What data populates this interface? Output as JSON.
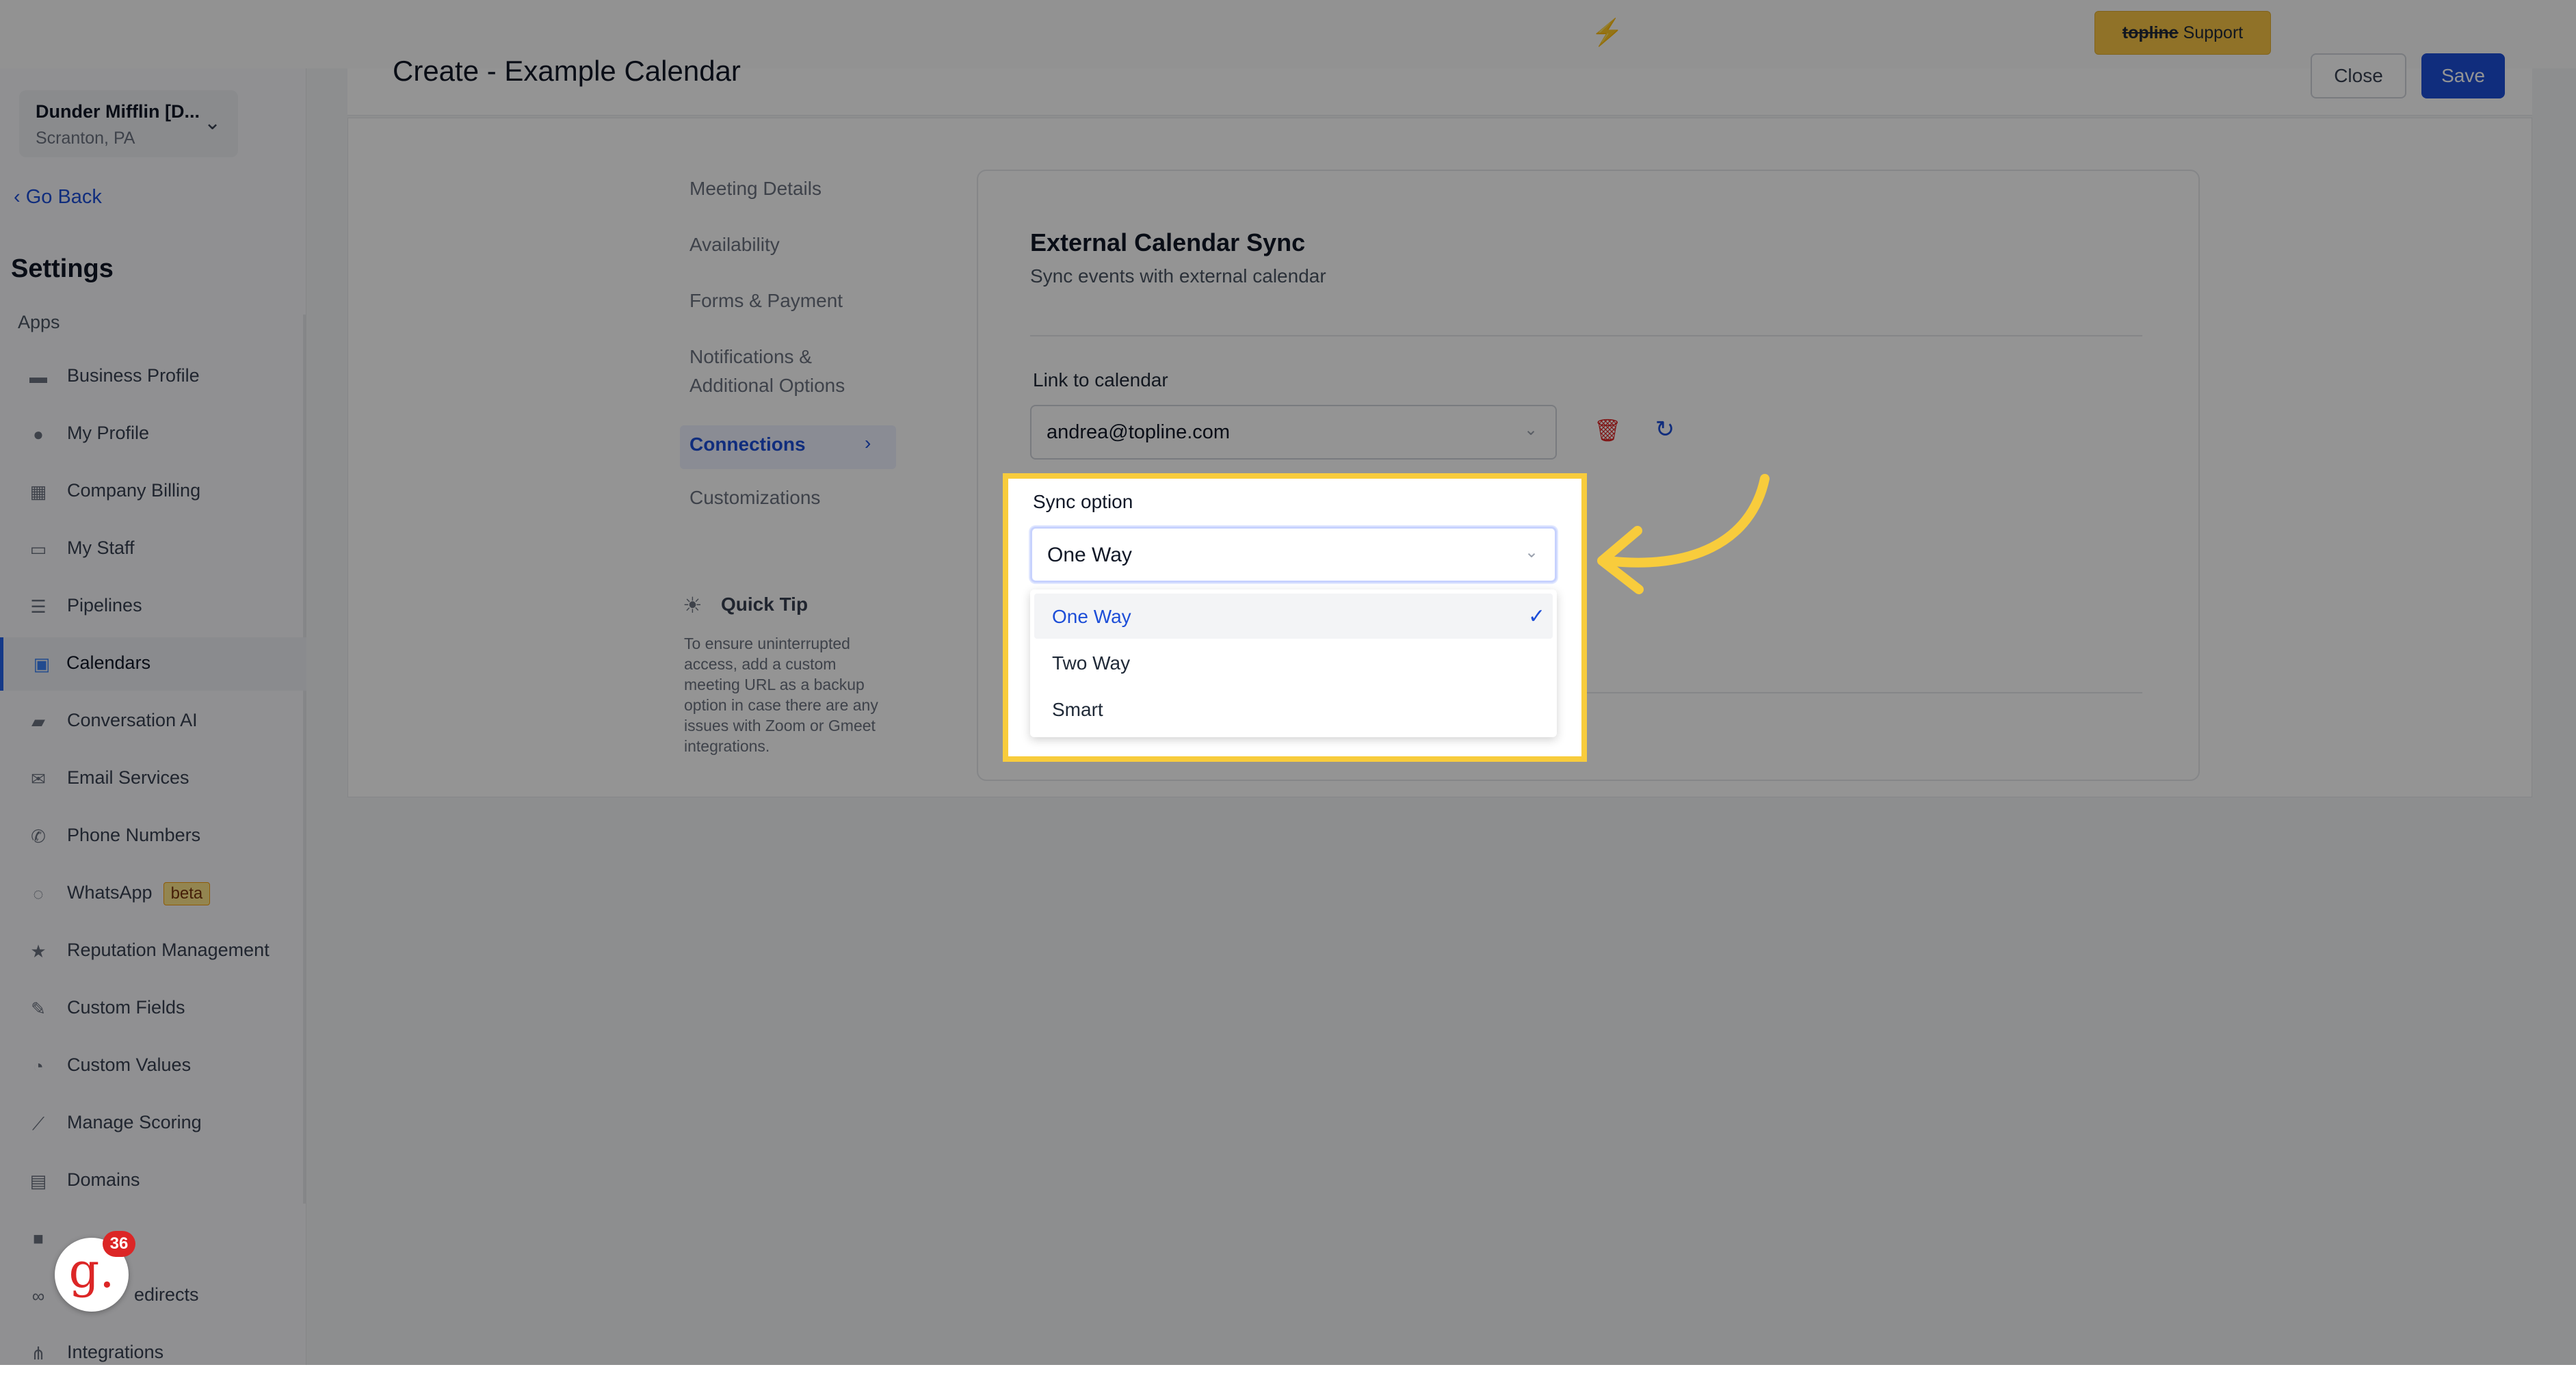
{
  "topbar": {
    "support_brand": "topline",
    "support_label": "Support"
  },
  "sidebar": {
    "account_name": "Dunder Mifflin [D...",
    "account_location": "Scranton, PA",
    "go_back": "Go Back",
    "settings_title": "Settings",
    "apps_label": "Apps",
    "beta_badge": "beta",
    "items": [
      {
        "label": "Business Profile",
        "icon": "briefcase-icon"
      },
      {
        "label": "My Profile",
        "icon": "user-icon"
      },
      {
        "label": "Company Billing",
        "icon": "grid-icon"
      },
      {
        "label": "My Staff",
        "icon": "inbox-icon"
      },
      {
        "label": "Pipelines",
        "icon": "filter-icon"
      },
      {
        "label": "Calendars",
        "icon": "calendar-icon"
      },
      {
        "label": "Conversation AI",
        "icon": "chat-icon"
      },
      {
        "label": "Email Services",
        "icon": "mail-icon"
      },
      {
        "label": "Phone Numbers",
        "icon": "phone-icon"
      },
      {
        "label": "WhatsApp",
        "icon": "whatsapp-icon"
      },
      {
        "label": "Reputation Management",
        "icon": "star-icon"
      },
      {
        "label": "Custom Fields",
        "icon": "custom-fields-icon"
      },
      {
        "label": "Custom Values",
        "icon": "pie-icon"
      },
      {
        "label": "Manage Scoring",
        "icon": "scoring-icon"
      },
      {
        "label": "Domains",
        "icon": "domain-icon"
      },
      {
        "label": "",
        "icon": "video-icon"
      },
      {
        "label": "edirects",
        "icon": "link-icon"
      },
      {
        "label": "Integrations",
        "icon": "integrations-icon"
      }
    ],
    "notification_badge": {
      "letter": "g.",
      "count": "36"
    }
  },
  "header": {
    "title": "Create - Example Calendar",
    "close_label": "Close",
    "save_label": "Save"
  },
  "subnav": {
    "items": [
      "Meeting Details",
      "Availability",
      "Forms & Payment",
      "Notifications &",
      "Additional Options",
      "Connections",
      "Customizations"
    ],
    "active": "Connections"
  },
  "quick_tip": {
    "title": "Quick Tip",
    "text": "To ensure uninterrupted access, add a custom meeting URL as a backup option in case there are any issues with Zoom or Gmeet integrations."
  },
  "sync_card": {
    "title": "External Calendar Sync",
    "subtitle": "Sync events with external calendar",
    "link_label": "Link to calendar",
    "link_value": "andrea@topline.com",
    "sync_label": "Sync option",
    "sync_value": "One Way",
    "options": [
      "One Way",
      "Two Way",
      "Smart"
    ],
    "selected_option": "One Way"
  },
  "colors": {
    "accent": "#1d4ed8",
    "highlight": "#f8cc3c",
    "support": "#f8c545",
    "danger": "#dc2626"
  }
}
